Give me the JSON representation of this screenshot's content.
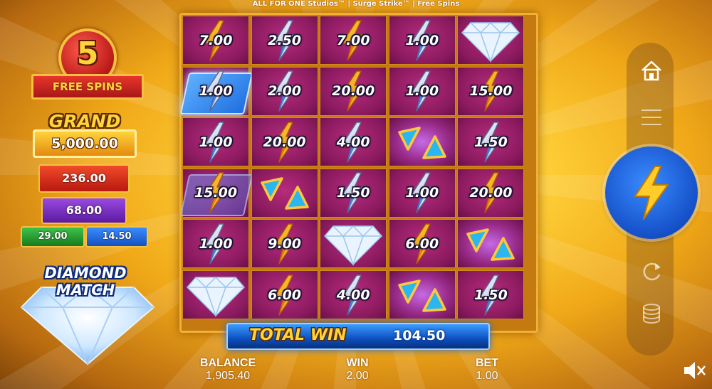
{
  "title": "ALL FOR ONE Studios™ | Surge Strike™ | Free Spins",
  "free_spins": {
    "count": "5",
    "label": "FREE SPINS"
  },
  "jackpots": {
    "grand_label": "GRAND",
    "grand": "5,000.00",
    "major": "236.00",
    "minor": "68.00",
    "mini_green": "29.00",
    "mini_blue": "14.50"
  },
  "feature_label": {
    "line1": "DIAMOND",
    "line2": "MATCH"
  },
  "grid": {
    "rows": [
      [
        {
          "kind": "bolt",
          "color": "gold",
          "value": "7.00"
        },
        {
          "kind": "bolt",
          "color": "silver",
          "value": "2.50"
        },
        {
          "kind": "bolt",
          "color": "gold",
          "value": "7.00"
        },
        {
          "kind": "bolt",
          "color": "silver",
          "value": "1.00"
        },
        {
          "kind": "diamond"
        }
      ],
      [
        {
          "kind": "bolt",
          "color": "silver",
          "value": "1.00",
          "sticky": "blue"
        },
        {
          "kind": "bolt",
          "color": "silver",
          "value": "2.00"
        },
        {
          "kind": "bolt",
          "color": "gold",
          "value": "20.00"
        },
        {
          "kind": "bolt",
          "color": "silver",
          "value": "1.00"
        },
        {
          "kind": "bolt",
          "color": "gold",
          "value": "15.00"
        }
      ],
      [
        {
          "kind": "bolt",
          "color": "silver",
          "value": "1.00"
        },
        {
          "kind": "bolt",
          "color": "gold",
          "value": "20.00"
        },
        {
          "kind": "bolt",
          "color": "silver",
          "value": "4.00"
        },
        {
          "kind": "triangles",
          "glow": true
        },
        {
          "kind": "bolt",
          "color": "silver",
          "value": "1.50"
        }
      ],
      [
        {
          "kind": "bolt",
          "color": "gold",
          "value": "15.00",
          "sticky": "faint"
        },
        {
          "kind": "triangles"
        },
        {
          "kind": "bolt",
          "color": "silver",
          "value": "1.50"
        },
        {
          "kind": "bolt",
          "color": "silver",
          "value": "1.00"
        },
        {
          "kind": "bolt",
          "color": "gold",
          "value": "20.00"
        }
      ],
      [
        {
          "kind": "bolt",
          "color": "silver",
          "value": "1.00"
        },
        {
          "kind": "bolt",
          "color": "gold",
          "value": "9.00"
        },
        {
          "kind": "diamond"
        },
        {
          "kind": "bolt",
          "color": "gold",
          "value": "6.00"
        },
        {
          "kind": "triangles",
          "glow": true
        }
      ],
      [
        {
          "kind": "diamond"
        },
        {
          "kind": "bolt",
          "color": "gold",
          "value": "6.00"
        },
        {
          "kind": "bolt",
          "color": "silver",
          "value": "4.00"
        },
        {
          "kind": "triangles",
          "glow": true
        },
        {
          "kind": "bolt",
          "color": "silver",
          "value": "1.50"
        }
      ]
    ]
  },
  "total_win": {
    "label": "TOTAL WIN",
    "value": "104.50"
  },
  "stats": {
    "balance_label": "BALANCE",
    "balance": "1,905.40",
    "win_label": "WIN",
    "win": "2.00",
    "bet_label": "BET",
    "bet": "1.00"
  },
  "controls": {
    "icons": [
      "home-icon",
      "menu-icon",
      "lightning-icon",
      "autoplay-icon",
      "coins-icon",
      "mute-icon"
    ]
  },
  "colors": {
    "gold_bolt": "#f7b62a",
    "silver_bolt": "#d9e3f2",
    "cell": "#8a1a5e",
    "spin_button": "#1d63d8"
  }
}
